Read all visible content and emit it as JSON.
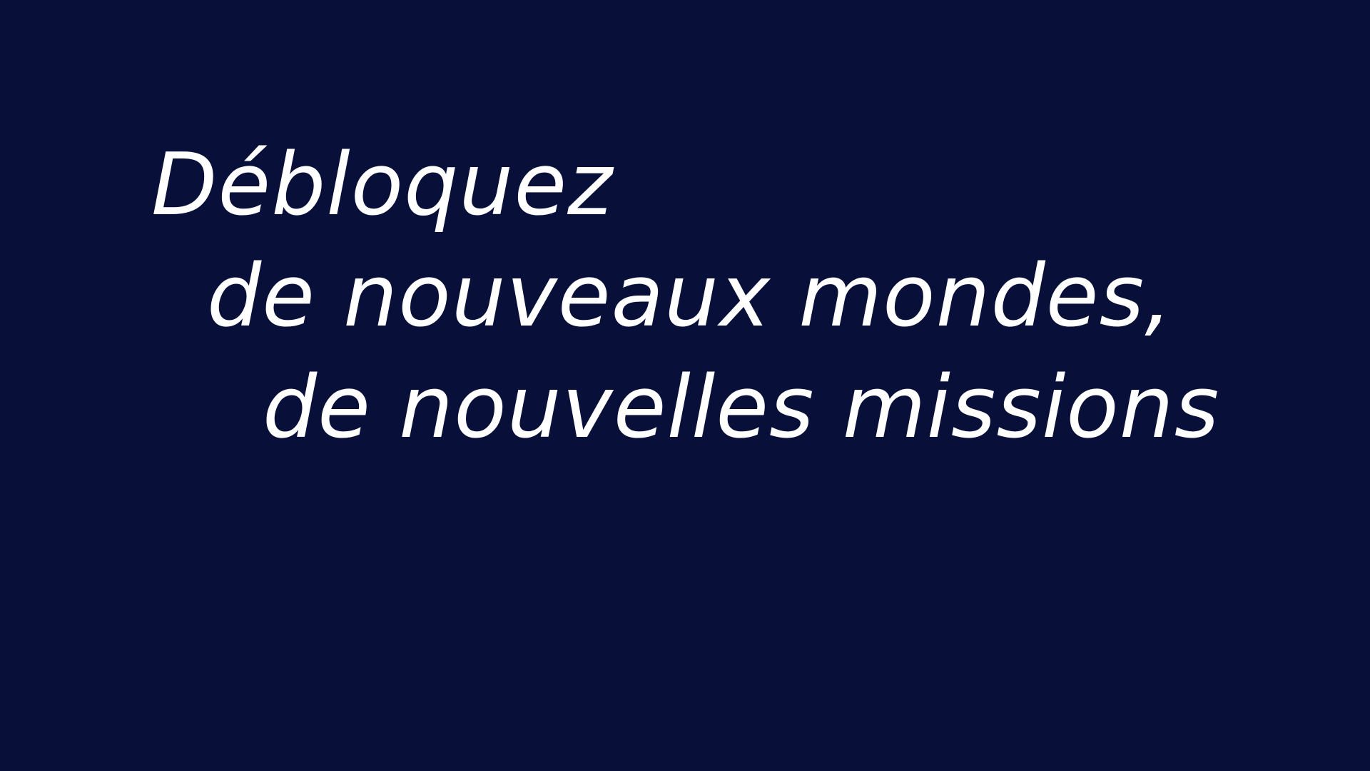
{
  "screen": {
    "background_color": "#08103a",
    "text_color": "#ffffff"
  },
  "headline": {
    "lines": [
      "Débloquez",
      "de nouveaux mondes,",
      "de nouvelles missions"
    ]
  }
}
